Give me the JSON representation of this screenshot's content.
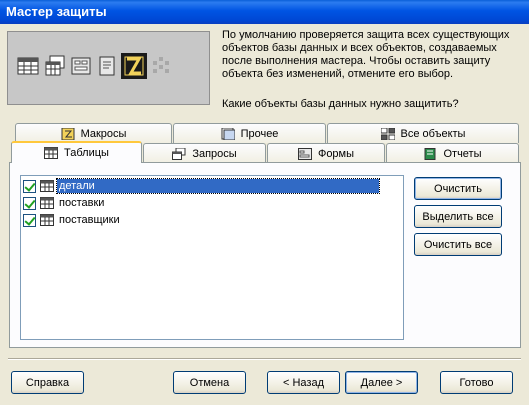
{
  "window": {
    "title": "Мастер защиты"
  },
  "hero": {
    "icons": [
      "table-icon",
      "query-icon",
      "form-icon",
      "report-icon",
      "macro-icon",
      "module-icon"
    ]
  },
  "description": "По умолчанию проверяется защита всех существующих объектов базы данных и всех объектов, создаваемых после выполнения мастера. Чтобы оставить защиту объекта без изменений, отмените его выбор.",
  "question": "Какие объекты базы данных нужно защитить?",
  "tabs": {
    "row_back": [
      {
        "label": "Макросы",
        "icon": "macro-icon"
      },
      {
        "label": "Прочее",
        "icon": "other-icon"
      },
      {
        "label": "Все объекты",
        "icon": "all-objects-icon"
      }
    ],
    "row_front": [
      {
        "label": "Таблицы",
        "icon": "table-icon",
        "active": true
      },
      {
        "label": "Запросы",
        "icon": "query-icon"
      },
      {
        "label": "Формы",
        "icon": "form-icon"
      },
      {
        "label": "Отчеты",
        "icon": "report-icon"
      }
    ]
  },
  "list": {
    "items": [
      {
        "label": "детали",
        "checked": true,
        "selected": true
      },
      {
        "label": "поставки",
        "checked": true,
        "selected": false
      },
      {
        "label": "поставщики",
        "checked": true,
        "selected": false
      }
    ]
  },
  "side_buttons": {
    "clear": "Очистить",
    "select_all": "Выделить все",
    "clear_all": "Очистить все"
  },
  "footer": {
    "help": "Справка",
    "cancel": "Отмена",
    "back": "< Назад",
    "next": "Далее >",
    "finish": "Готово"
  },
  "colors": {
    "title_bar": "#0054e3",
    "selection": "#316ac5",
    "tab_highlight": "#ffc83c"
  }
}
